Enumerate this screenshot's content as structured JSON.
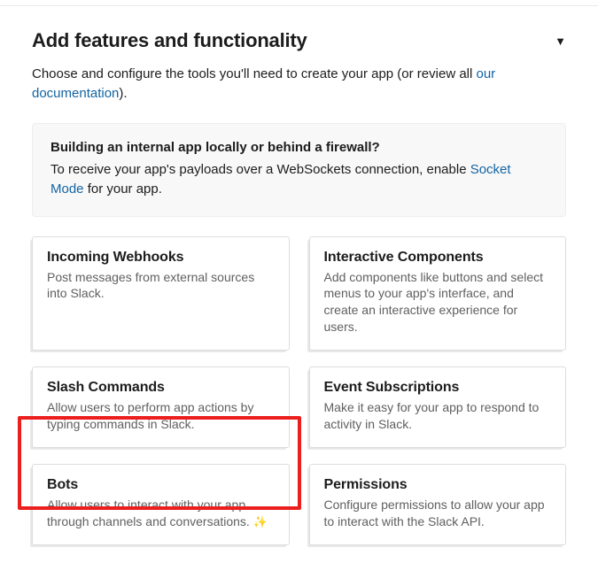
{
  "header": {
    "title": "Add features and functionality"
  },
  "intro": {
    "prefix": "Choose and configure the tools you'll need to create your app (or review all ",
    "link_text": "our documentation",
    "suffix": ")."
  },
  "info": {
    "title": "Building an internal app locally or behind a firewall?",
    "body_prefix": "To receive your app's payloads over a WebSockets connection, enable ",
    "link_text": "Socket Mode",
    "body_suffix": " for your app."
  },
  "cards": {
    "incoming_webhooks": {
      "title": "Incoming Webhooks",
      "desc": "Post messages from external sources into Slack."
    },
    "interactive_components": {
      "title": "Interactive Components",
      "desc": "Add components like buttons and select menus to your app's interface, and create an interactive experience for users."
    },
    "slash_commands": {
      "title": "Slash Commands",
      "desc": "Allow users to perform app actions by typing commands in Slack."
    },
    "event_subscriptions": {
      "title": "Event Subscriptions",
      "desc": "Make it easy for your app to respond to activity in Slack."
    },
    "bots": {
      "title": "Bots",
      "desc": "Allow users to interact with your app through channels and conversations. "
    },
    "permissions": {
      "title": "Permissions",
      "desc": "Configure permissions to allow your app to interact with the Slack API."
    }
  },
  "icons": {
    "sparkle": "✨"
  }
}
